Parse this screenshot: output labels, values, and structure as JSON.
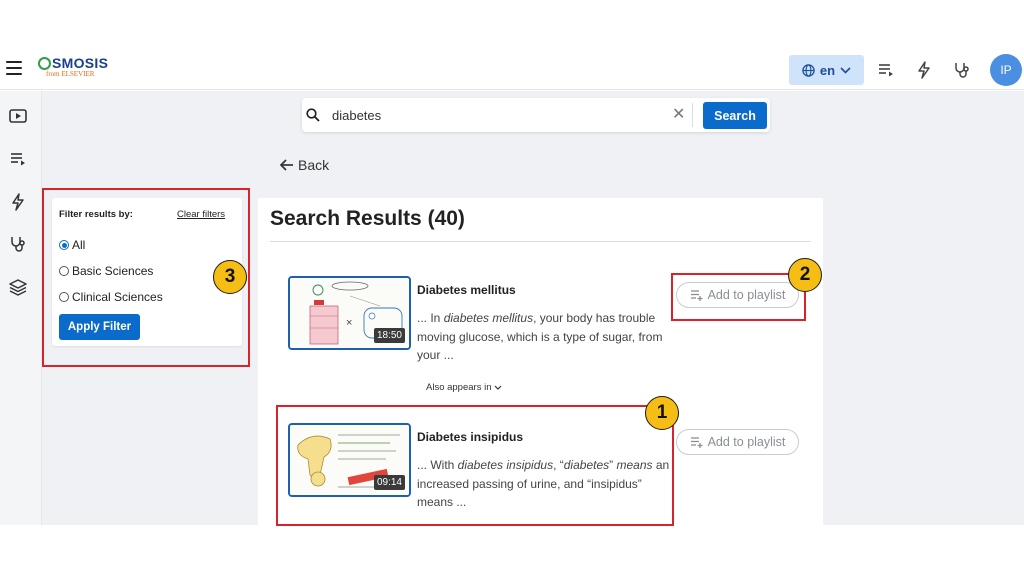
{
  "header": {
    "logo_text": "SMOSIS",
    "logo_sub": "from ELSEVIER",
    "lang_label": "en",
    "avatar_initials": "IP",
    "icons": [
      "menu-icon",
      "globe-icon",
      "chevron-down-icon",
      "playlist-icon",
      "flash-icon",
      "stethoscope-icon"
    ]
  },
  "sidebar": {
    "icons": [
      "video-icon",
      "playlist-icon",
      "flash-icon",
      "stethoscope-icon",
      "layers-icon"
    ]
  },
  "search": {
    "value": "diabetes",
    "button_label": "Search"
  },
  "nav": {
    "back_label": "Back"
  },
  "filter": {
    "title": "Filter results by:",
    "clear_label": "Clear filters",
    "options": [
      {
        "label": "All",
        "selected": true
      },
      {
        "label": "Basic Sciences",
        "selected": false
      },
      {
        "label": "Clinical Sciences",
        "selected": false
      }
    ],
    "apply_label": "Apply Filter"
  },
  "results": {
    "heading": "Search Results (40)",
    "items": [
      {
        "title": "Diabetes mellitus",
        "duration": "18:50",
        "snippet_pre": "... In ",
        "snippet_em": "diabetes mellitus",
        "snippet_post": ", your body has trouble moving glucose, which is a type of sugar, from your ...",
        "also_label": "Also appears in",
        "playlist_label": "Add to playlist"
      },
      {
        "title": "Diabetes insipidus",
        "duration": "09:14",
        "snippet_pre": "... With ",
        "snippet_em": "diabetes insipidus",
        "snippet_mid": ", “",
        "snippet_em2": "diabetes",
        "snippet_mid2": "” ",
        "snippet_em3": "means",
        "snippet_post": " an increased passing of urine, and “insipidus” means ...",
        "playlist_label": "Add to playlist"
      }
    ]
  },
  "annotations": [
    {
      "label": "1"
    },
    {
      "label": "2"
    },
    {
      "label": "3"
    }
  ],
  "colors": {
    "primary": "#0b6bcb",
    "annotation_red": "#d8232a",
    "annotation_badge": "#f6bd14",
    "lang_bg": "#cfe3fb"
  }
}
